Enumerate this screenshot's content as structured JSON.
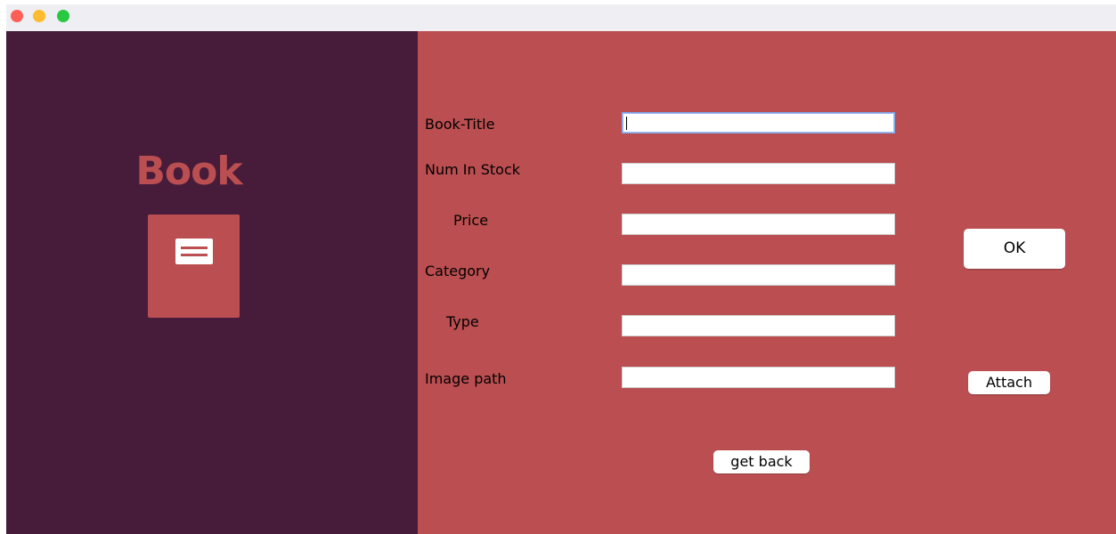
{
  "colors": {
    "sidebar_bg": "#461c3a",
    "form_bg": "#bb4e51",
    "accent": "#bb4e51",
    "traffic_close": "#ff5f57",
    "traffic_minimize": "#febc2e",
    "traffic_maximize": "#28c840"
  },
  "window": {
    "controls": [
      "close",
      "minimize",
      "maximize"
    ]
  },
  "sidebar": {
    "title": "Book",
    "icon": "book-list-icon"
  },
  "form": {
    "fields": [
      {
        "label": "Book-Title",
        "value": ""
      },
      {
        "label": "Num In Stock",
        "value": ""
      },
      {
        "label": "Price",
        "value": ""
      },
      {
        "label": "Category",
        "value": ""
      },
      {
        "label": "Type",
        "value": ""
      },
      {
        "label": "Image path",
        "value": ""
      }
    ],
    "ok_label": "OK",
    "attach_label": "Attach",
    "back_label": "get back"
  }
}
